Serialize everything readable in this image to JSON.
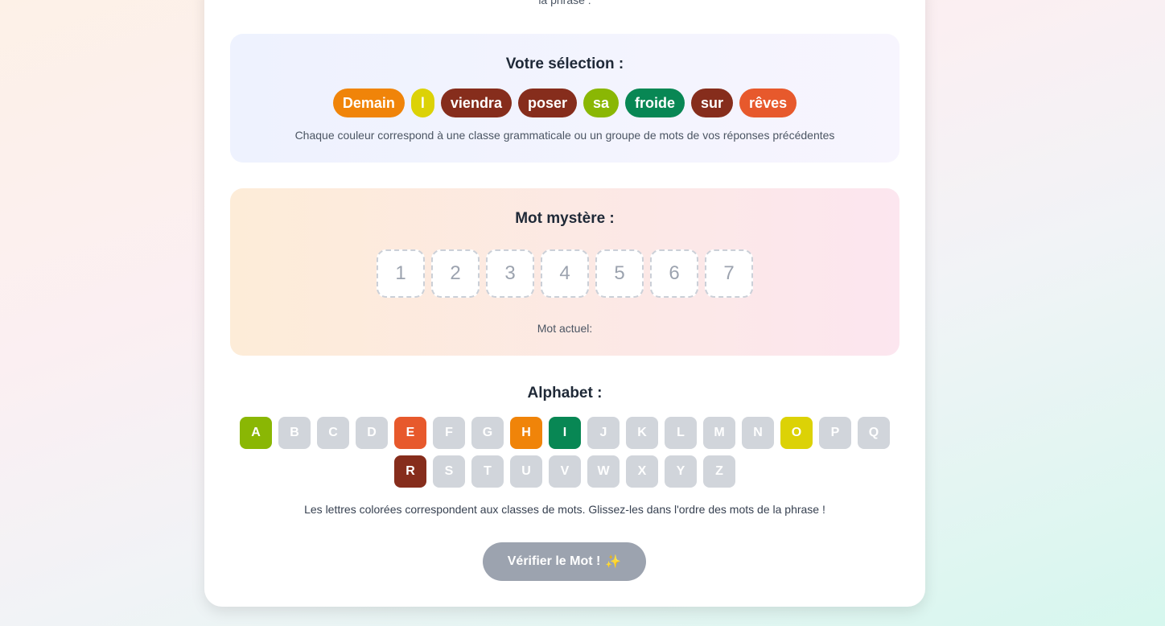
{
  "header": {
    "partial_text": "la phrase :"
  },
  "selection": {
    "title": "Votre sélection :",
    "words": [
      {
        "text": "Demain",
        "color": "#f08409"
      },
      {
        "text": "l",
        "color": "#dcd206"
      },
      {
        "text": "viendra",
        "color": "#862d1c"
      },
      {
        "text": "poser",
        "color": "#862d1c"
      },
      {
        "text": "sa",
        "color": "#8ab704"
      },
      {
        "text": "froide",
        "color": "#088754"
      },
      {
        "text": "sur",
        "color": "#862d1c"
      },
      {
        "text": "rêves",
        "color": "#e7592c"
      }
    ],
    "note": "Chaque couleur correspond à une classe grammaticale ou un groupe de mots de vos réponses précédentes"
  },
  "mystery": {
    "title": "Mot mystère :",
    "slots": [
      "1",
      "2",
      "3",
      "4",
      "5",
      "6",
      "7"
    ],
    "current_label": "Mot actuel:"
  },
  "alphabet": {
    "title": "Alphabet :",
    "letters": [
      {
        "letter": "A",
        "color": "#8ab704"
      },
      {
        "letter": "B",
        "color": "#d1d5db"
      },
      {
        "letter": "C",
        "color": "#d1d5db"
      },
      {
        "letter": "D",
        "color": "#d1d5db"
      },
      {
        "letter": "E",
        "color": "#e7592c"
      },
      {
        "letter": "F",
        "color": "#d1d5db"
      },
      {
        "letter": "G",
        "color": "#d1d5db"
      },
      {
        "letter": "H",
        "color": "#f08409"
      },
      {
        "letter": "I",
        "color": "#088754"
      },
      {
        "letter": "J",
        "color": "#d1d5db"
      },
      {
        "letter": "K",
        "color": "#d1d5db"
      },
      {
        "letter": "L",
        "color": "#d1d5db"
      },
      {
        "letter": "M",
        "color": "#d1d5db"
      },
      {
        "letter": "N",
        "color": "#d1d5db"
      },
      {
        "letter": "O",
        "color": "#dcd206"
      },
      {
        "letter": "P",
        "color": "#d1d5db"
      },
      {
        "letter": "Q",
        "color": "#d1d5db"
      },
      {
        "letter": "R",
        "color": "#862d1c"
      },
      {
        "letter": "S",
        "color": "#d1d5db"
      },
      {
        "letter": "T",
        "color": "#d1d5db"
      },
      {
        "letter": "U",
        "color": "#d1d5db"
      },
      {
        "letter": "V",
        "color": "#d1d5db"
      },
      {
        "letter": "W",
        "color": "#d1d5db"
      },
      {
        "letter": "X",
        "color": "#d1d5db"
      },
      {
        "letter": "Y",
        "color": "#d1d5db"
      },
      {
        "letter": "Z",
        "color": "#d1d5db"
      }
    ],
    "note": "Les lettres colorées correspondent aux classes de mots. Glissez-les dans l'ordre des mots de la phrase !"
  },
  "verify_button": {
    "label": "Vérifier le Mot !",
    "icon": "✨"
  }
}
